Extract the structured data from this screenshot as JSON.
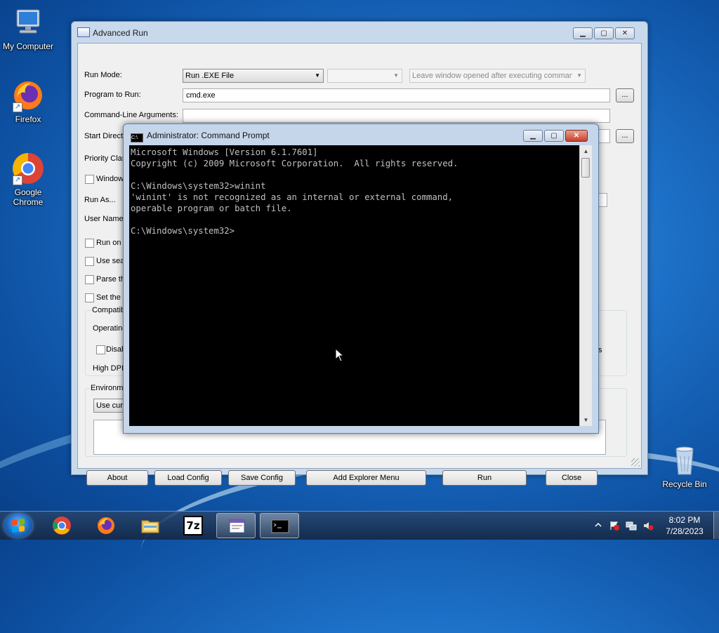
{
  "desktop": {
    "icons": [
      {
        "label": "My Computer"
      },
      {
        "label": "Firefox"
      },
      {
        "label": "Google Chrome"
      },
      {
        "label": "Recycle Bin"
      }
    ]
  },
  "advanced_run": {
    "title": "Advanced Run",
    "run_mode_label": "Run Mode:",
    "run_mode_value": "Run .EXE File",
    "after_exec_value": "Leave window opened after executing command",
    "program_label": "Program to Run:",
    "program_value": "cmd.exe",
    "browse_label": "...",
    "args_label": "Command-Line Arguments:",
    "start_dir_label": "Start Directory:",
    "priority_label": "Priority Clas",
    "window_label": "Window",
    "run_as_label": "Run As...",
    "user_name_label": "User Name:",
    "run_on_label": "Run on r",
    "use_search_label": "Use sear",
    "parse_label": "Parse th",
    "set_label": "Set the p",
    "compat_label": "Compatib",
    "operating_label": "Operating",
    "disable_label": "Disab",
    "s_label": "s",
    "high_dpi_label": "High DPI",
    "environment_label": "Environme",
    "use_current_label": "Use curr",
    "buttons": {
      "about": "About",
      "load_config": "Load Config",
      "save_config": "Save Config",
      "add_explorer_menu": "Add Explorer Menu",
      "run": "Run",
      "close": "Close"
    }
  },
  "cmd": {
    "title": "Administrator:  Command Prompt",
    "output": "Microsoft Windows [Version 6.1.7601]\nCopyright (c) 2009 Microsoft Corporation.  All rights reserved.\n\nC:\\Windows\\system32>winint\n'winint' is not recognized as an internal or external command,\noperable program or batch file.\n\nC:\\Windows\\system32>"
  },
  "taskbar": {
    "items": [
      "chrome",
      "firefox",
      "explorer",
      "7zip",
      "advanced-run",
      "cmd"
    ],
    "sevenzip_label": "7z",
    "time": "8:02 PM",
    "date": "7/28/2023"
  },
  "colors": {
    "cmd_bg": "#000000",
    "cmd_fg": "#c0c0c0",
    "close_red": "#c7402a"
  }
}
